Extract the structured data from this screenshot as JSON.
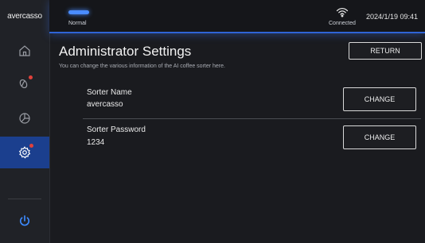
{
  "brand": "avercasso",
  "header": {
    "status_label": "Normal",
    "connection_label": "Connected",
    "datetime": "2024/1/19 09:41"
  },
  "sidebar": {
    "items": [
      {
        "icon": "home-icon"
      },
      {
        "icon": "beans-icon"
      },
      {
        "icon": "pie-chart-icon"
      },
      {
        "icon": "settings-icon",
        "active": true
      },
      {
        "icon": "power-icon"
      }
    ]
  },
  "main": {
    "title": "Administrator Settings",
    "description": "You can change the various information of the AI coffee sorter here.",
    "return_label": "RETURN",
    "fields": [
      {
        "label": "Sorter Name",
        "value": "avercasso",
        "button": "CHANGE"
      },
      {
        "label": "Sorter Password",
        "value": "1234",
        "button": "CHANGE"
      }
    ]
  },
  "colors": {
    "accent": "#2f64d6",
    "active_sidebar": "#1b3f8e",
    "notification_dot": "#e0413b",
    "power_icon": "#3d8bff"
  }
}
